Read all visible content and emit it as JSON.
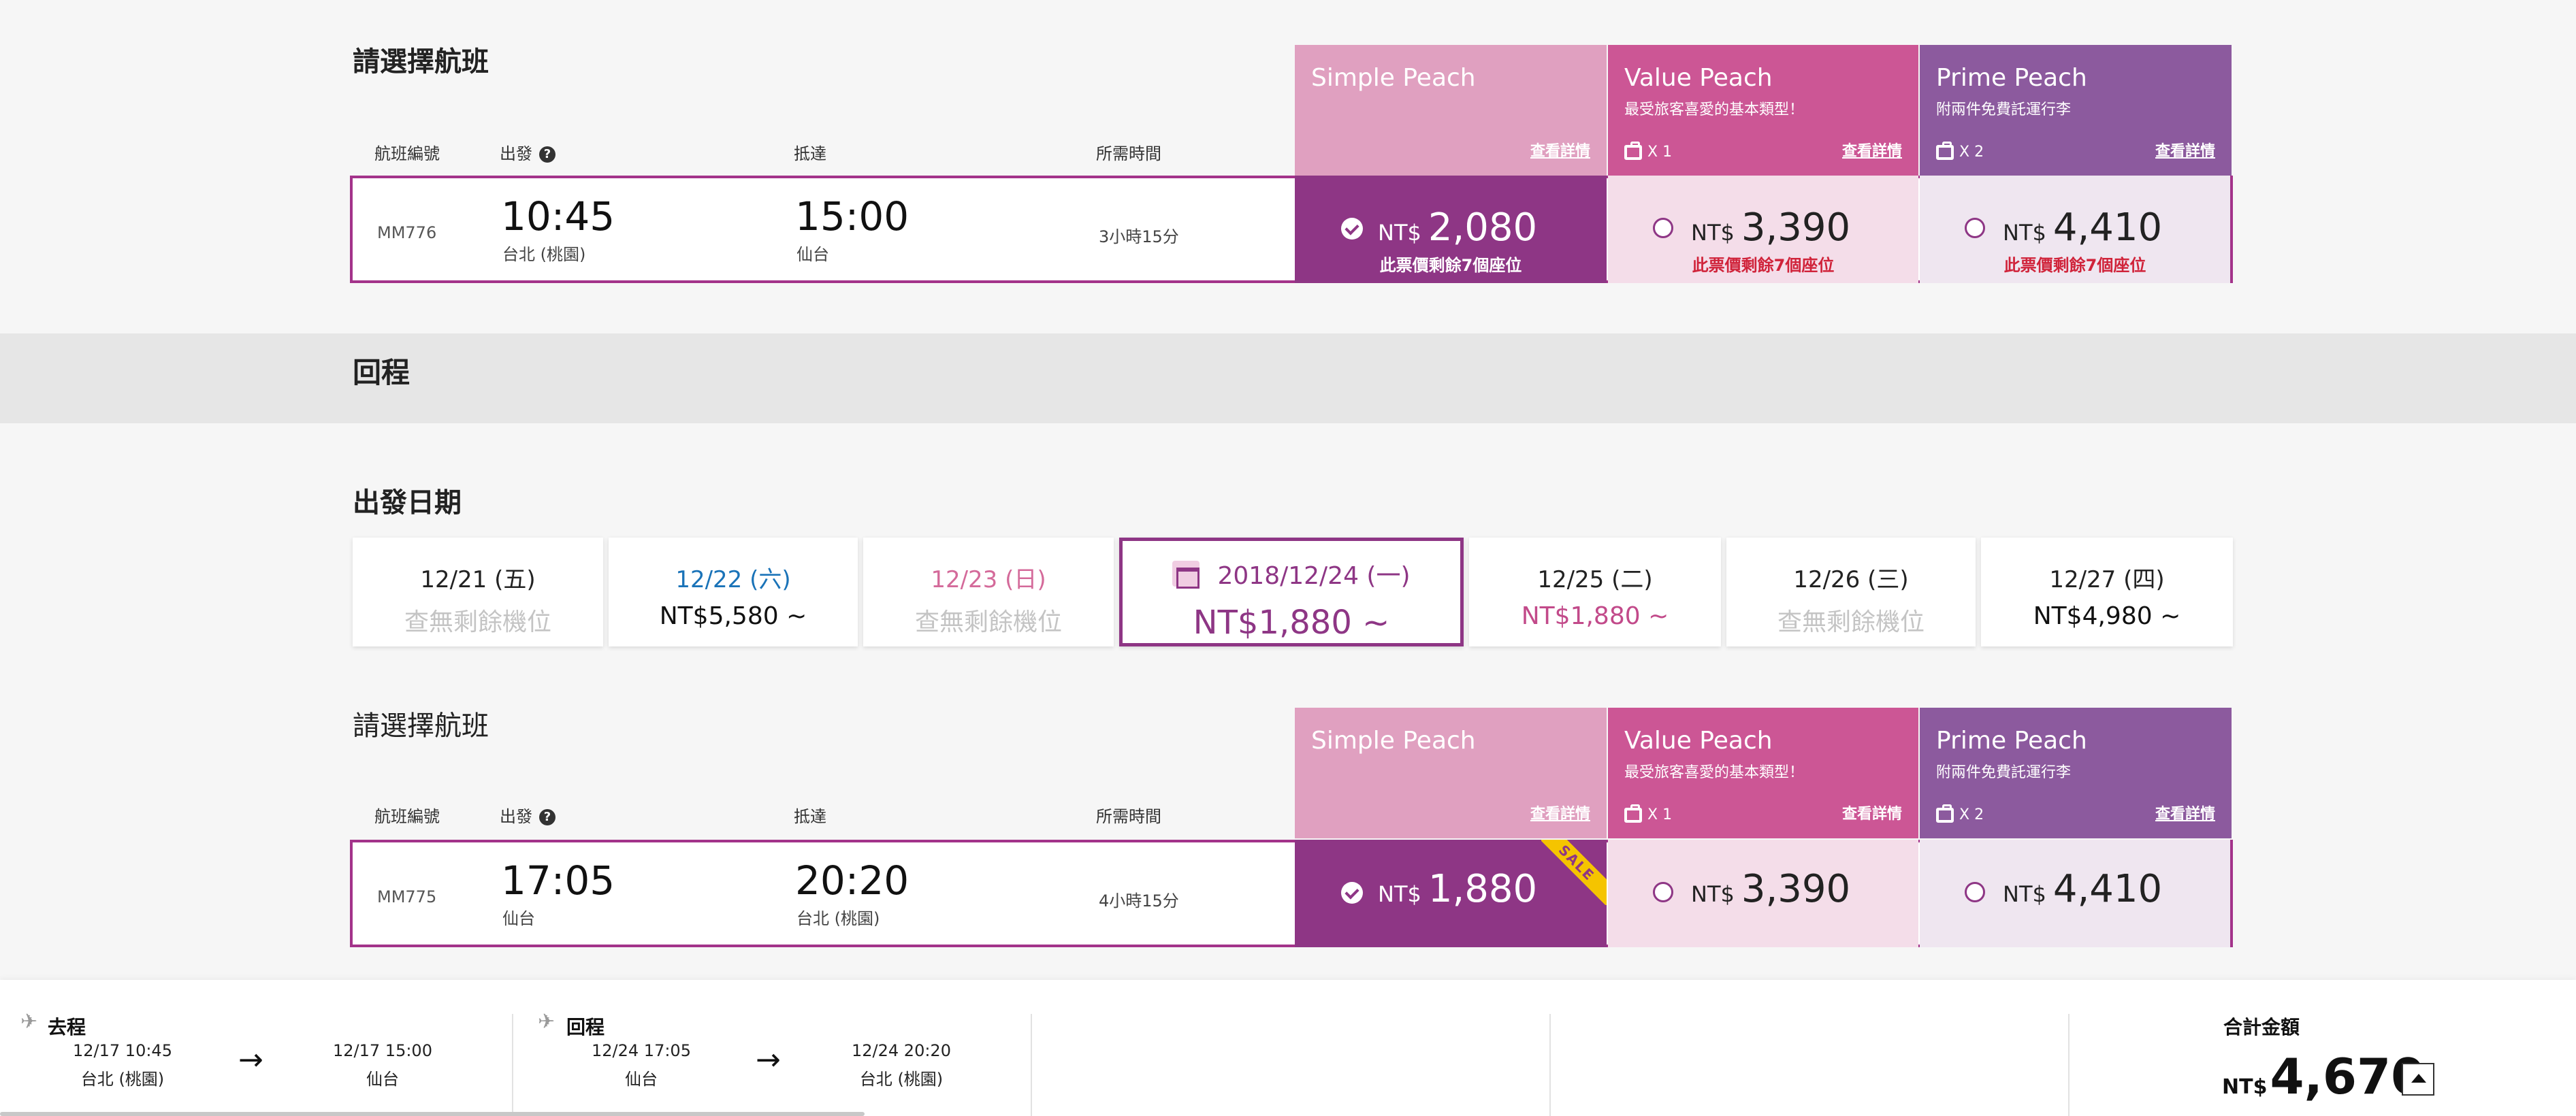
{
  "outbound": {
    "section_title": "請選擇航班",
    "columns": {
      "flight_no": "航班編號",
      "depart": "出發",
      "arrive": "抵達",
      "duration": "所需時間"
    },
    "fares": {
      "simple": {
        "name": "Simple Peach",
        "detail": "查看詳情"
      },
      "value": {
        "name": "Value Peach",
        "sub": "最受旅客喜愛的基本類型！",
        "bag": "X 1",
        "detail": "查看詳情"
      },
      "prime": {
        "name": "Prime Peach",
        "sub": "附兩件免費託運行李",
        "bag": "X 2",
        "detail": "查看詳情"
      }
    },
    "flight": {
      "flight_no": "MM776",
      "depart_time": "10:45",
      "depart_place": "台北 (桃園)",
      "arrive_time": "15:00",
      "arrive_place": "仙台",
      "duration": "3小時15分",
      "simple": {
        "currency": "NT$",
        "amount": "2,080",
        "seats": "此票價剩餘7個座位",
        "selected": true
      },
      "value": {
        "currency": "NT$",
        "amount": "3,390",
        "seats": "此票價剩餘7個座位"
      },
      "prime": {
        "currency": "NT$",
        "amount": "4,410",
        "seats": "此票價剩餘7個座位"
      }
    }
  },
  "return": {
    "band_title": "回程",
    "date_title": "出發日期",
    "dates": [
      {
        "date": "12/21 (五)",
        "price": "查無剩餘機位"
      },
      {
        "date": "12/22 (六)",
        "price": "NT$5,580 ~"
      },
      {
        "date": "12/23 (日)",
        "price": "查無剩餘機位"
      },
      {
        "date": "2018/12/24 (一)",
        "price": "NT$1,880 ~",
        "active": true
      },
      {
        "date": "12/25 (二)",
        "price": "NT$1,880 ~"
      },
      {
        "date": "12/26 (三)",
        "price": "查無剩餘機位"
      },
      {
        "date": "12/27 (四)",
        "price": "NT$4,980 ~"
      }
    ],
    "section_title": "請選擇航班",
    "columns": {
      "flight_no": "航班編號",
      "depart": "出發",
      "arrive": "抵達",
      "duration": "所需時間"
    },
    "fares": {
      "simple": {
        "name": "Simple Peach",
        "detail": "查看詳情"
      },
      "value": {
        "name": "Value Peach",
        "sub": "最受旅客喜愛的基本類型！",
        "bag": "X 1",
        "detail": "查看詳情"
      },
      "prime": {
        "name": "Prime Peach",
        "sub": "附兩件免費託運行李",
        "bag": "X 2",
        "detail": "查看詳情"
      }
    },
    "flight": {
      "flight_no": "MM775",
      "depart_time": "17:05",
      "depart_place": "仙台",
      "arrive_time": "20:20",
      "arrive_place": "台北 (桃園)",
      "duration": "4小時15分",
      "sale_badge": "SALE",
      "simple": {
        "currency": "NT$",
        "amount": "1,880",
        "selected": true
      },
      "value": {
        "currency": "NT$",
        "amount": "3,390"
      },
      "prime": {
        "currency": "NT$",
        "amount": "4,410"
      }
    }
  },
  "summary": {
    "outbound": {
      "label": "去程",
      "dep_dt": "12/17 10:45",
      "dep_place": "台北 (桃園)",
      "arr_dt": "12/17 15:00",
      "arr_place": "仙台"
    },
    "return": {
      "label": "回程",
      "dep_dt": "12/24 17:05",
      "dep_place": "仙台",
      "arr_dt": "12/24 20:20",
      "arr_place": "台北 (桃園)"
    },
    "total_label": "合計金額",
    "total_currency": "NT$",
    "total_amount": "4,670"
  },
  "colors": {
    "selected_purple": "#8e3685",
    "simple_peach": "#e0a0c0",
    "value_peach": "#cc5695",
    "prime_peach": "#8c5a9e",
    "alert_red": "#d0233a"
  },
  "icons": {
    "help": "question-circle-icon",
    "baggage": "suitcase-icon",
    "calendar": "calendar-icon",
    "plane": "plane-icon",
    "arrow": "arrow-right-icon",
    "toggle": "caret-up-icon"
  }
}
